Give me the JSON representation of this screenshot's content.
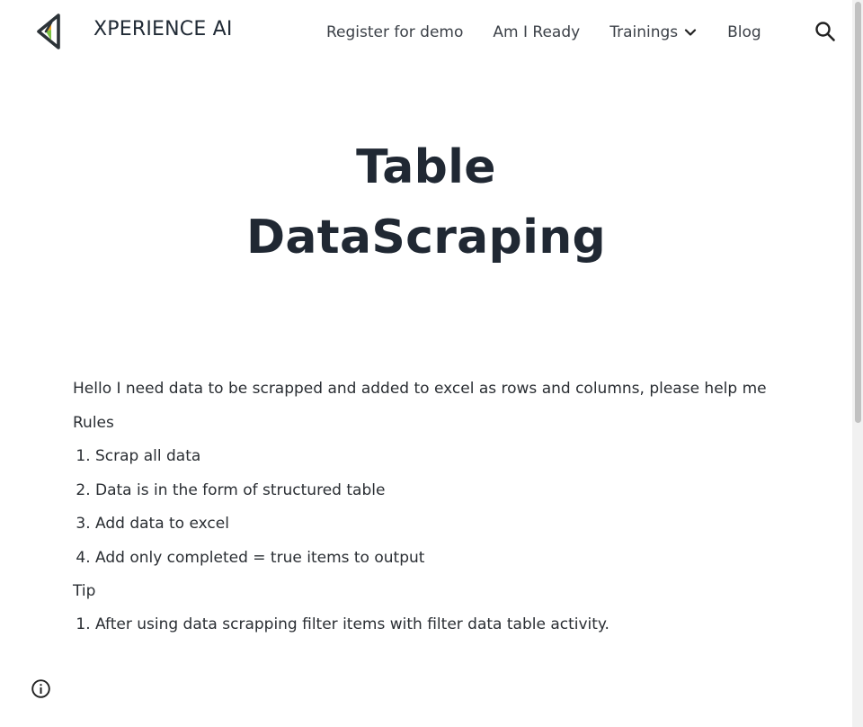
{
  "header": {
    "site_title": "XPERIENCE AI",
    "nav": {
      "register": "Register for demo",
      "ready": "Am I Ready",
      "trainings": "Trainings",
      "blog": "Blog"
    },
    "logo_icon": "triangle-arrow-logo",
    "search_icon": "search-icon",
    "chevron_icon": "chevron-down-icon"
  },
  "hero": {
    "title_line1": "Table",
    "title_line2": "DataScraping"
  },
  "content": {
    "intro": "Hello I need data to be scrapped and added to excel as rows and columns, please help me",
    "rules_label": "Rules",
    "rules": [
      "Scrap all data",
      "Data is in the form of structured table",
      "Add data to excel",
      "Add only completed = true items to output"
    ],
    "tip_label": "Tip",
    "tips": [
      "After using data scrapping filter items with filter data table activity."
    ]
  },
  "colors": {
    "title": "#202833",
    "text": "#2a2e33",
    "logo_accent_green": "#7cc242",
    "logo_accent_orange": "#f5a623",
    "logo_dark": "#2c3338"
  }
}
